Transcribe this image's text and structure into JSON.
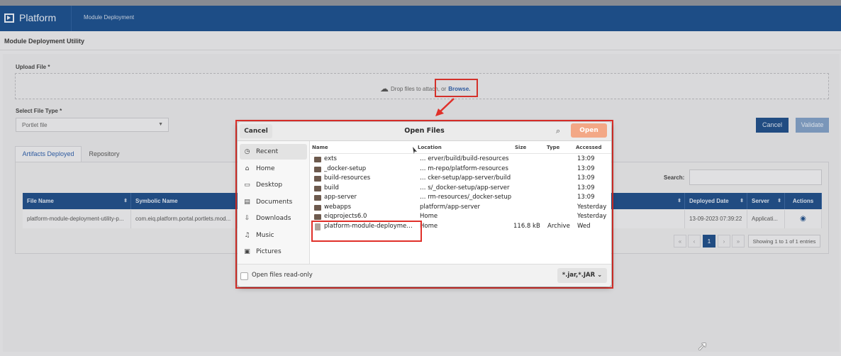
{
  "app": {
    "name": "Platform",
    "breadcrumb": "Module Deployment"
  },
  "page": {
    "title": "Module Deployment Utility"
  },
  "upload": {
    "label": "Upload File *",
    "drop_text": "Drop files to attach, or",
    "browse": "Browse."
  },
  "file_type": {
    "label": "Select File Type *",
    "value": "Portlet file"
  },
  "actions": {
    "cancel": "Cancel",
    "validate": "Validate"
  },
  "tabs": [
    "Artifacts Deployed",
    "Repository"
  ],
  "table": {
    "search_label": "Search:",
    "columns": [
      "File Name",
      "Symbolic Name",
      "Deployed Date",
      "Server",
      "Actions"
    ],
    "row": {
      "file_name": "platform-module-deployment-utility-p...",
      "symbolic_name": "com.eiq.platform.portal.portlets.mod...",
      "deployed_date": "13-09-2023 07:39:22",
      "server": "Applicati..."
    },
    "pager": {
      "first": "«",
      "prev": "‹",
      "page": "1",
      "next": "›",
      "last": "»"
    },
    "showing": "Showing 1 to 1 of 1 entries"
  },
  "dialog": {
    "title": "Open Files",
    "cancel": "Cancel",
    "open": "Open",
    "sidebar": [
      "Recent",
      "Home",
      "Desktop",
      "Documents",
      "Downloads",
      "Music",
      "Pictures"
    ],
    "columns": {
      "name": "Name",
      "location": "Location",
      "size": "Size",
      "type": "Type",
      "accessed": "Accessed"
    },
    "files": [
      {
        "name": "exts",
        "location": "… erver/build/build-resources",
        "size": "",
        "type": "",
        "accessed": "13:09"
      },
      {
        "name": "_docker-setup",
        "location": "… m-repo/platform-resources",
        "size": "",
        "type": "",
        "accessed": "13:09"
      },
      {
        "name": "build-resources",
        "location": "… cker-setup/app-server/build",
        "size": "",
        "type": "",
        "accessed": "13:09"
      },
      {
        "name": "build",
        "location": "… s/_docker-setup/app-server",
        "size": "",
        "type": "",
        "accessed": "13:09"
      },
      {
        "name": "app-server",
        "location": "… rm-resources/_docker-setup",
        "size": "",
        "type": "",
        "accessed": "13:09"
      },
      {
        "name": "webapps",
        "location": "platform/app-server",
        "size": "",
        "type": "",
        "accessed": "Yesterday"
      },
      {
        "name": "eiqprojects6.0",
        "location": "Home",
        "size": "",
        "type": "",
        "accessed": "Yesterday"
      },
      {
        "name": "platform-module-deployme…",
        "location": "Home",
        "size": "116.8 kB",
        "type": "Archive",
        "accessed": "Wed"
      }
    ],
    "readonly_label": "Open files read-only",
    "filter": "*.jar,*.JAR"
  },
  "colors": {
    "brand": "#1b4f8c",
    "accent": "#e0302a",
    "open_button": "#f3a886"
  }
}
